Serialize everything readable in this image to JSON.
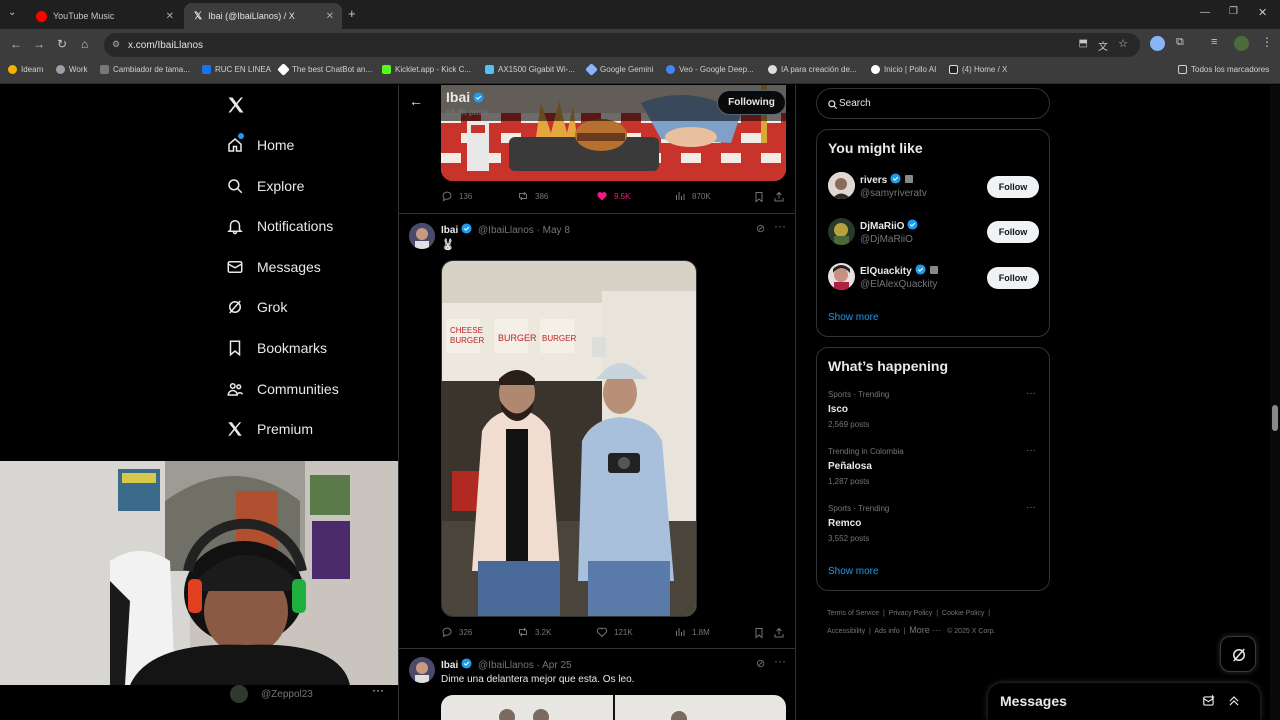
{
  "browser": {
    "tabs": [
      {
        "title": "YouTube Music"
      },
      {
        "title": "Ibai (@IbaiLlanos) / X"
      }
    ],
    "url": "x.com/IbaiLlanos",
    "bookmarks": [
      "Ideam",
      "Work",
      "Cambiador de tama...",
      "RUC EN LINEA",
      "The best ChatBot an...",
      "Kicklet.app - Kick C...",
      "AX1500 Gigabit Wi-...",
      "Google Gemini",
      "Veo - Google Deep...",
      "IA para creación de...",
      "Inicio | Pollo AI",
      "(4) Home / X"
    ],
    "all_bookmarks": "Todos los marcadores"
  },
  "nav": {
    "items": [
      "Home",
      "Explore",
      "Notifications",
      "Messages",
      "Grok",
      "Bookmarks",
      "Communities",
      "Premium"
    ],
    "bottom_handle": "@Zeppol23"
  },
  "profile_header": {
    "name": "Ibai",
    "posts": "68.8K posts",
    "following_button": "Following"
  },
  "posts": [
    {
      "stats": {
        "replies": "136",
        "reposts": "386",
        "likes": "9.5K",
        "views": "870K"
      }
    },
    {
      "name": "Ibai",
      "handle": "@IbaiLlanos",
      "date": "May 8",
      "text": "🐰",
      "stats": {
        "replies": "326",
        "reposts": "3.2K",
        "likes": "121K",
        "views": "1.8M"
      }
    },
    {
      "name": "Ibai",
      "handle": "@IbaiLlanos",
      "date": "Apr 25",
      "text": "Dime una delantera mejor que esta. Os leo."
    }
  ],
  "search": {
    "placeholder": "Search"
  },
  "you_might_like": {
    "title": "You might like",
    "users": [
      {
        "name": "rivers",
        "handle": "@samyriveratv",
        "button": "Follow"
      },
      {
        "name": "DjMaRiiO",
        "handle": "@DjMaRiiO",
        "button": "Follow"
      },
      {
        "name": "ElQuackity",
        "handle": "@ElAlexQuackity",
        "button": "Follow"
      }
    ],
    "show_more": "Show more"
  },
  "whats_happening": {
    "title": "What’s happening",
    "trends": [
      {
        "context": "Sports · Trending",
        "topic": "Isco",
        "count": "2,569 posts"
      },
      {
        "context": "Trending in Colombia",
        "topic": "Peñalosa",
        "count": "1,287 posts"
      },
      {
        "context": "Sports · Trending",
        "topic": "Remco",
        "count": "3,552 posts"
      }
    ],
    "show_more": "Show more"
  },
  "footer": {
    "links": [
      "Terms of Service",
      "Privacy Policy",
      "Cookie Policy",
      "Accessibility",
      "Ads info",
      "More ···"
    ],
    "copyright": "© 2025 X Corp."
  },
  "messages_drawer": {
    "title": "Messages"
  },
  "colors": {
    "accent": "#1d9bf0",
    "like": "#f91880",
    "background": "#000000",
    "border": "#2f3336"
  }
}
